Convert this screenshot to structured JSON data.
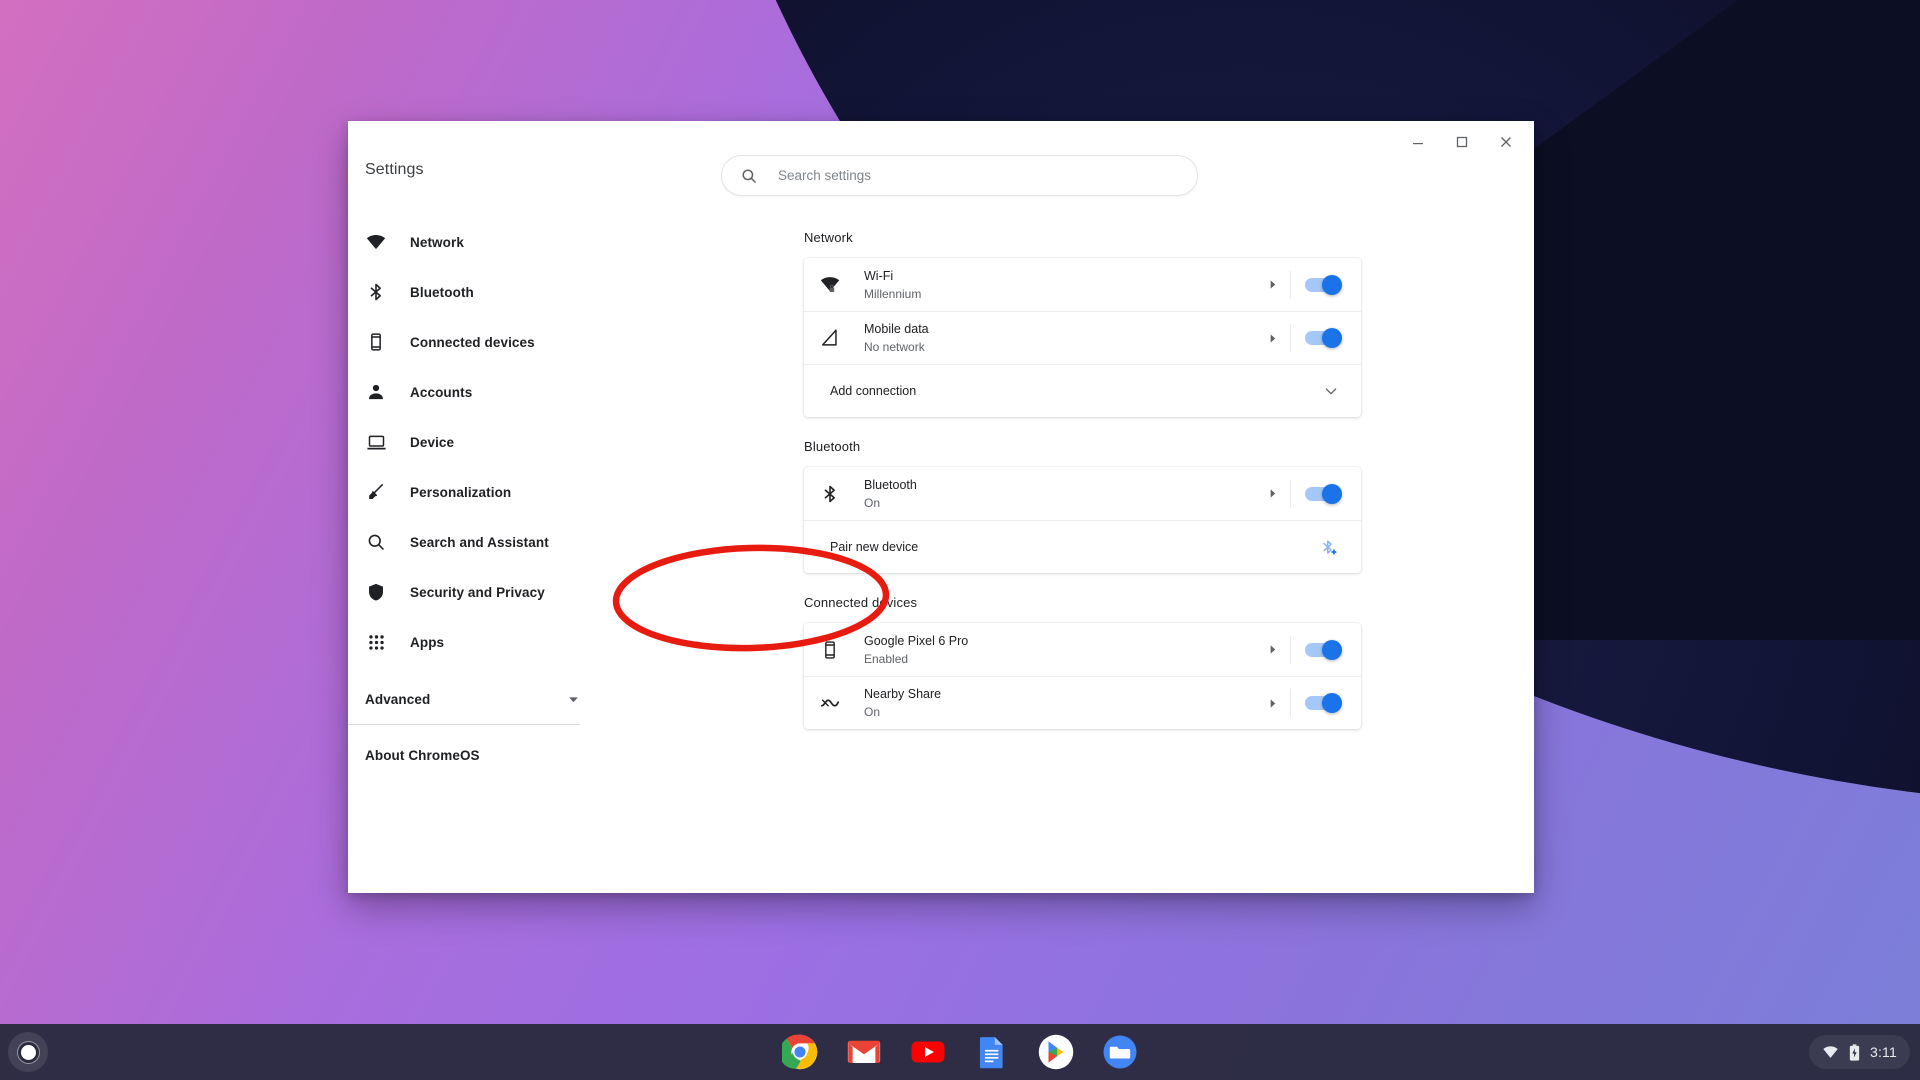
{
  "window": {
    "title": "Settings",
    "controls": [
      {
        "name": "minimize",
        "glyph": "minimize-icon"
      },
      {
        "name": "maximize",
        "glyph": "maximize-icon"
      },
      {
        "name": "close",
        "glyph": "close-icon"
      }
    ]
  },
  "search": {
    "placeholder": "Search settings",
    "value": "",
    "icon": "search-icon"
  },
  "sidebar": {
    "title": "Settings",
    "items": [
      {
        "label": "Network",
        "icon": "wifi-icon"
      },
      {
        "label": "Bluetooth",
        "icon": "bluetooth-icon"
      },
      {
        "label": "Connected devices",
        "icon": "phone-icon"
      },
      {
        "label": "Accounts",
        "icon": "person-icon"
      },
      {
        "label": "Device",
        "icon": "laptop-icon"
      },
      {
        "label": "Personalization",
        "icon": "brush-icon"
      },
      {
        "label": "Search and Assistant",
        "icon": "search-icon"
      },
      {
        "label": "Security and Privacy",
        "icon": "shield-icon"
      },
      {
        "label": "Apps",
        "icon": "grid-apps-icon"
      }
    ],
    "advanced": {
      "label": "Advanced",
      "icon": "chevron-down-icon"
    },
    "about": {
      "label": "About ChromeOS"
    }
  },
  "sections": [
    {
      "title": "Network",
      "rows": [
        {
          "title": "Wi-Fi",
          "subtitle": "Millennium",
          "icon": "wifi-lock-icon",
          "toggle": "on",
          "arrow": true
        },
        {
          "title": "Mobile data",
          "subtitle": "No network",
          "icon": "cellular-icon",
          "toggle": "on",
          "arrow": true
        }
      ],
      "footer": {
        "label": "Add connection",
        "icon": "chevron-down-icon"
      }
    },
    {
      "title": "Bluetooth",
      "rows": [
        {
          "title": "Bluetooth",
          "subtitle": "On",
          "icon": "bluetooth-icon",
          "toggle": "on",
          "arrow": true
        }
      ],
      "footer": {
        "label": "Pair new device",
        "icon": "bluetooth-add-icon"
      }
    },
    {
      "title": "Connected devices",
      "rows": [
        {
          "title": "Google Pixel 6 Pro",
          "subtitle": "Enabled",
          "icon": "phone-icon",
          "toggle": "on",
          "arrow": true
        },
        {
          "title": "Nearby Share",
          "subtitle": "On",
          "icon": "nearby-share-icon",
          "toggle": "on",
          "arrow": true
        }
      ]
    }
  ],
  "annotation": {
    "shape": "ellipse",
    "color": "#e81b10",
    "target": "bluetooth-card"
  },
  "shelf": {
    "launcher": {
      "name": "launcher-button"
    },
    "apps": [
      {
        "name": "chrome",
        "icon": "chrome-icon"
      },
      {
        "name": "gmail",
        "icon": "gmail-icon"
      },
      {
        "name": "youtube",
        "icon": "youtube-icon"
      },
      {
        "name": "google-docs",
        "icon": "docs-icon"
      },
      {
        "name": "play-store",
        "icon": "play-store-icon"
      },
      {
        "name": "files",
        "icon": "files-icon"
      }
    ],
    "tray": {
      "wifi_icon": "wifi-icon",
      "battery_icon": "battery-charging-icon",
      "time": "3:11"
    }
  },
  "colors": {
    "accent_blue": "#1a73e8",
    "toggle_track": "#a5c8fa",
    "annotation_red": "#e81b10",
    "text_primary": "#202124",
    "text_secondary": "#5f6368",
    "shelf_bg": "#2a2b3e"
  }
}
